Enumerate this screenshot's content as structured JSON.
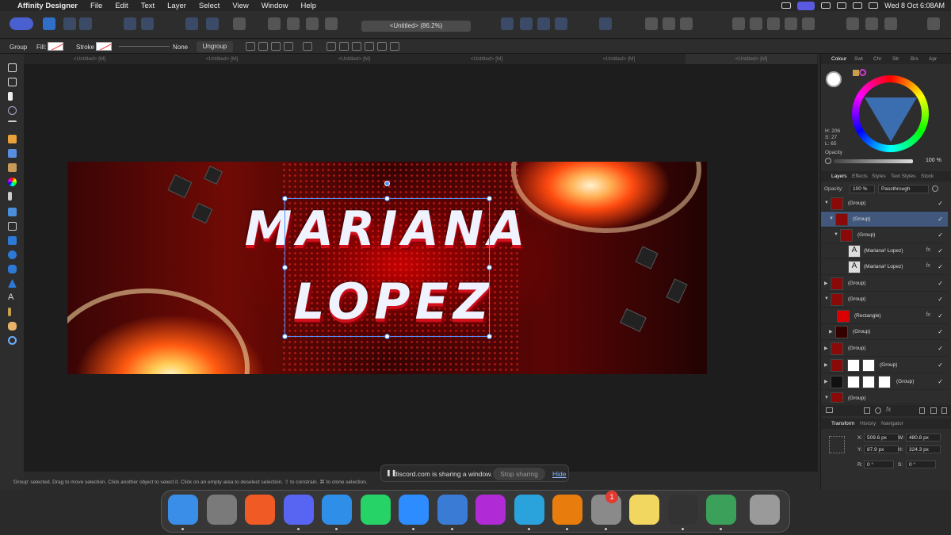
{
  "menubar": {
    "app_name": "Affinity Designer",
    "menus": [
      "File",
      "Edit",
      "Text",
      "Layer",
      "Select",
      "View",
      "Window",
      "Help"
    ],
    "clock": "Wed 8 Oct  6:08AM"
  },
  "toolbar": {
    "doc_title": "<Untitled> (86.2%)"
  },
  "context": {
    "group_label": "Group",
    "fill_label": "Fill:",
    "stroke_label": "Stroke",
    "stroke_value": "None",
    "ungroup_label": "Ungroup"
  },
  "tabs": [
    "<Untitled> [M]",
    "<Untitled> [M]",
    "<Untitled> [M]",
    "<Untitled> [M]",
    "<Untitled> [M]",
    "<Untitled> [M]"
  ],
  "artwork": {
    "line1": "MARIANA",
    "line2": "LOPEZ"
  },
  "colour_panel": {
    "tabs": [
      "Colour",
      "Swt",
      "Chr",
      "Str",
      "Brs",
      "Apr"
    ],
    "h": "H: 206",
    "s": "S: 27",
    "l": "L: 65",
    "opacity_label": "Opacity",
    "opacity_value": "100 %"
  },
  "layers_panel": {
    "tabs": [
      "Layers",
      "Effects",
      "Styles",
      "Text Styles",
      "Stock"
    ],
    "opacity_label": "Opacity:",
    "opacity_value": "100 %",
    "blend_mode": "Passthrough",
    "rows": [
      {
        "name": "(Group)"
      },
      {
        "name": "(Group)"
      },
      {
        "name": "(Group)"
      },
      {
        "name": "(Mariana² Lopez)"
      },
      {
        "name": "(Mariana² Lopez)"
      },
      {
        "name": "(Group)"
      },
      {
        "name": "(Group)"
      },
      {
        "name": "(Rectangle)"
      },
      {
        "name": "(Group)"
      },
      {
        "name": "(Group)"
      },
      {
        "name": "(Group)"
      },
      {
        "name": "(Group)"
      },
      {
        "name": "(Group)"
      }
    ]
  },
  "transform_panel": {
    "tabs": [
      "Transform",
      "History",
      "Navigator"
    ],
    "x": "509.6 px",
    "y": "87.9 px",
    "w": "480.8 px",
    "h": "324.3 px",
    "r": "0 °",
    "s": "0 °"
  },
  "status": {
    "text": "'Group' selected. Drag to move selection. Click another object to select it. Click on an empty area to deselect selection. ⇧ to constrain. ⌘ to clone selection."
  },
  "share_bar": {
    "message": "discord.com is sharing a window.",
    "stop_label": "Stop sharing",
    "hide_label": "Hide"
  },
  "dock": {
    "apps": [
      "Finder",
      "Launchpad",
      "Brave",
      "Discord",
      "Safari",
      "WhatsApp",
      "Zoom",
      "Affinity Designer",
      "Affinity Photo",
      "Telegram",
      "Blender",
      "System Settings",
      "Notes",
      "Activity Monitor",
      "MetaTrader 4",
      "Trash"
    ],
    "settings_badge": "1",
    "colors": [
      "#3a8ee8",
      "#7a7a7a",
      "#f05a24",
      "#5865f2",
      "#2f8fe8",
      "#25d366",
      "#2d8cff",
      "#3a7bd5",
      "#b02bd6",
      "#2aa3dd",
      "#e87d0d",
      "#8a8a8a",
      "#f1d660",
      "#333333",
      "#3aa05a",
      "#9a9a9a"
    ]
  }
}
